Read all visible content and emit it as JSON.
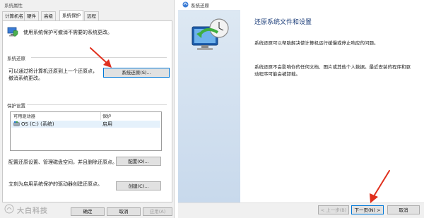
{
  "left_dialog": {
    "title": "系统属性",
    "tabs": [
      "计算机名",
      "硬件",
      "高级",
      "系统保护",
      "远程"
    ],
    "active_tab": 3,
    "intro_text": "使用系统保护可撤消不需要的系统更改。",
    "system_restore": {
      "section_label": "系统还原",
      "description": "可以通过将计算机还原到上一个还原点，撤消系统更改。",
      "button": "系统还原(S)..."
    },
    "protection_settings": {
      "section_label": "保护设置",
      "columns": [
        "可用驱动器",
        "保护"
      ],
      "rows": [
        {
          "drive": "OS (C:) (系统)",
          "protection": "启用"
        }
      ]
    },
    "configure": {
      "description": "配置还原设置、管理磁盘空间，并且删除还原点。",
      "button": "配置(O)..."
    },
    "create": {
      "description": "立刻为启用系统保护的驱动器创建还原点。",
      "button": "创建(C)..."
    },
    "footer": {
      "ok": "确定",
      "cancel": "取消",
      "apply": "应用(A)"
    },
    "watermark": "大白科技"
  },
  "right_dialog": {
    "title": "系统还原",
    "heading": "还原系统文件和设置",
    "para1": "系统还原可以帮助解决使计算机运行缓慢或停止响应的问题。",
    "para2": "系统还原不会影响你的任何文档、图片或其他个人数据。最近安装的程序和驱动程序可能会被卸载。",
    "footer": {
      "back": "< 上一步(B)",
      "next": "下一页(N) >",
      "cancel": "取消"
    }
  },
  "colors": {
    "accent": "#0078d7",
    "arrow": "#e0301e",
    "dialog_bg": "#f0f0f0"
  }
}
